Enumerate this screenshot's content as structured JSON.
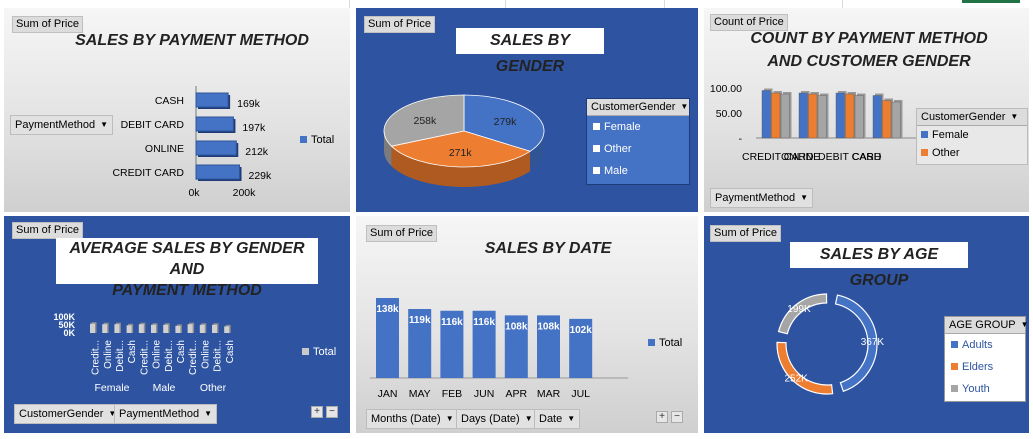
{
  "colors": {
    "blue": "#4472c4",
    "orange": "#ed7d31",
    "gray": "#a5a5a5",
    "panel_blue": "#2e54a1"
  },
  "payment": {
    "field_tag": "Sum of Price",
    "title": "SALES BY PAYMENT METHOD",
    "filter_label": "PaymentMethod",
    "legend": "Total"
  },
  "gender": {
    "field_tag": "Sum of Price",
    "title": "SALES BY GENDER",
    "legend_title": "CustomerGender"
  },
  "count": {
    "field_tag": "Count of Price",
    "title_line1": "COUNT BY PAYMENT METHOD",
    "title_line2": "AND CUSTOMER GENDER",
    "legend_title": "CustomerGender",
    "filter_label": "PaymentMethod"
  },
  "avg": {
    "field_tag": "Sum of Price",
    "title_line1": "AVERAGE SALES BY GENDER AND",
    "title_line2": "PAYMENT METHOD",
    "legend": "Total",
    "filter1": "CustomerGender",
    "filter2": "PaymentMethod",
    "plus": "+",
    "minus": "−"
  },
  "date": {
    "field_tag": "Sum of Price",
    "title": "SALES BY DATE",
    "legend": "Total",
    "filter1": "Months (Date)",
    "filter2": "Days (Date)",
    "filter3": "Date",
    "plus": "+",
    "minus": "−"
  },
  "age": {
    "field_tag": "Sum of Price",
    "title": "SALES BY AGE GROUP",
    "legend_title": "AGE GROUP"
  },
  "chart_data": [
    {
      "type": "bar",
      "orientation": "horizontal",
      "title": "SALES BY PAYMENT METHOD",
      "categories": [
        "CASH",
        "DEBIT CARD",
        "ONLINE",
        "CREDIT CARD"
      ],
      "values": [
        169,
        197,
        212,
        229
      ],
      "data_labels": [
        "169k",
        "197k",
        "212k",
        "229k"
      ],
      "x_ticks": [
        "0k",
        "200k"
      ],
      "xlim": [
        0,
        200
      ],
      "series": [
        {
          "name": "Total",
          "values": [
            169,
            197,
            212,
            229
          ]
        }
      ],
      "legend_position": "right"
    },
    {
      "type": "pie",
      "title": "SALES BY GENDER",
      "categories": [
        "Female",
        "Other",
        "Male"
      ],
      "values": [
        279,
        271,
        258
      ],
      "data_labels": [
        "279k",
        "271k",
        "258k"
      ],
      "legend_title": "CustomerGender",
      "legend_position": "right"
    },
    {
      "type": "bar",
      "title": "COUNT BY PAYMENT METHOD AND CUSTOMER GENDER",
      "categories": [
        "CREDIT CARD",
        "ONLINE",
        "DEBIT CARD",
        "CASH"
      ],
      "series": [
        {
          "name": "Female",
          "values": [
            95,
            90,
            90,
            85
          ]
        },
        {
          "name": "Other",
          "values": [
            90,
            88,
            88,
            75
          ]
        },
        {
          "name": "",
          "values": [
            88,
            85,
            85,
            72
          ]
        }
      ],
      "y_ticks": [
        "100.00",
        "50.00",
        "-"
      ],
      "ylim": [
        0,
        100
      ],
      "legend_title": "CustomerGender",
      "legend_position": "right"
    },
    {
      "type": "bar",
      "title": "AVERAGE SALES BY GENDER AND PAYMENT METHOD",
      "groups": [
        "Female",
        "Male",
        "Other"
      ],
      "categories": [
        "Credit...",
        "Online",
        "Debit...",
        "Cash",
        "Credit...",
        "Online",
        "Debit...",
        "Cash",
        "Credit...",
        "Online",
        "Debit...",
        "Cash"
      ],
      "values": [
        85,
        80,
        80,
        70,
        80,
        75,
        75,
        65,
        80,
        75,
        75,
        60
      ],
      "y_ticks": [
        "100K",
        "50K",
        "0K"
      ],
      "ylim": [
        0,
        100
      ],
      "series": [
        {
          "name": "Total",
          "values": [
            85,
            80,
            80,
            70,
            80,
            75,
            75,
            65,
            80,
            75,
            75,
            60
          ]
        }
      ],
      "legend_position": "right"
    },
    {
      "type": "bar",
      "title": "SALES BY DATE",
      "categories": [
        "JAN",
        "MAY",
        "FEB",
        "JUN",
        "APR",
        "MAR",
        "JUL"
      ],
      "values": [
        138,
        119,
        116,
        116,
        108,
        108,
        102
      ],
      "data_labels": [
        "138k",
        "119k",
        "116k",
        "116k",
        "108k",
        "108k",
        "102k"
      ],
      "series": [
        {
          "name": "Total",
          "values": [
            138,
            119,
            116,
            116,
            108,
            108,
            102
          ]
        }
      ],
      "legend_position": "right"
    },
    {
      "type": "pie",
      "variant": "doughnut",
      "title": "SALES BY AGE GROUP",
      "categories": [
        "Adults",
        "Elders",
        "Youth"
      ],
      "values": [
        367,
        252,
        199
      ],
      "data_labels": [
        "367K",
        "252K",
        "199K"
      ],
      "legend_title": "AGE GROUP",
      "legend_position": "right"
    }
  ]
}
